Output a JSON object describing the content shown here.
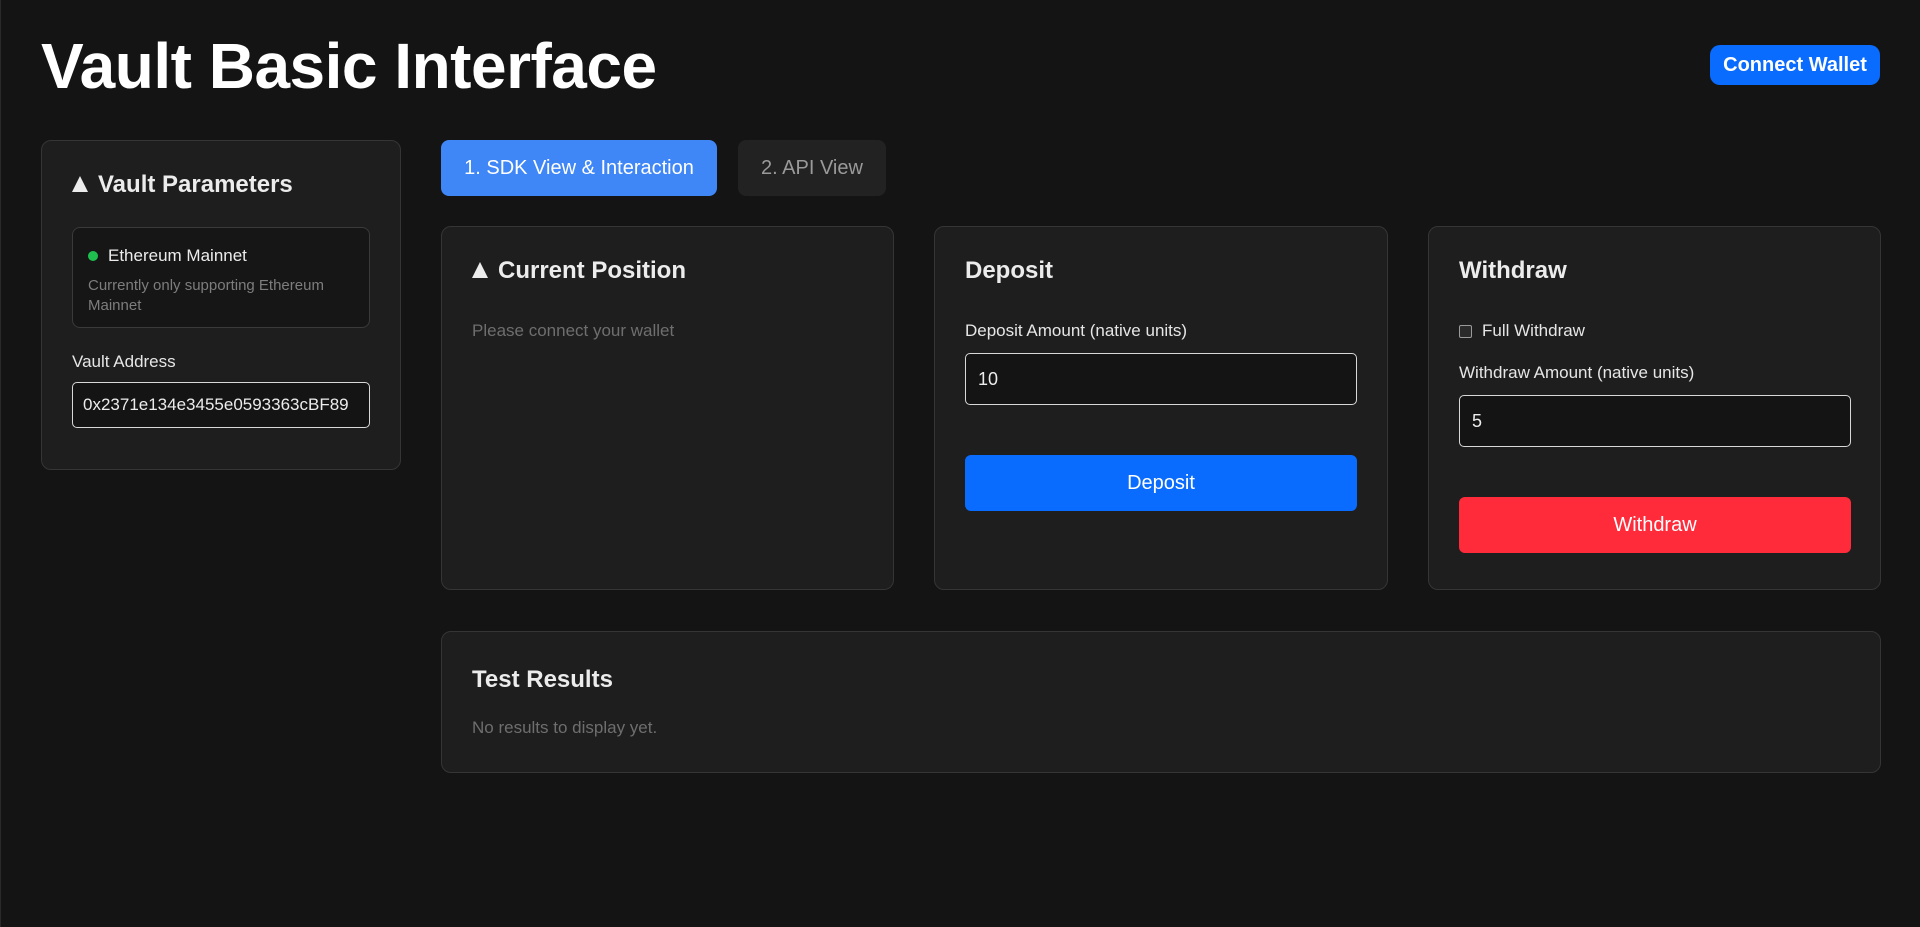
{
  "header": {
    "title": "Vault Basic Interface",
    "connect_label": "Connect Wallet"
  },
  "sidebar": {
    "title": "Vault Parameters",
    "network_name": "Ethereum Mainnet",
    "network_note": "Currently only supporting Ethereum Mainnet",
    "address_label": "Vault Address",
    "address_value": "0x2371e134e3455e0593363cBF89"
  },
  "tabs": [
    {
      "label": "1. SDK View & Interaction",
      "active": true
    },
    {
      "label": "2. API View",
      "active": false
    }
  ],
  "position": {
    "title": "Current Position",
    "empty_text": "Please connect your wallet"
  },
  "deposit": {
    "title": "Deposit",
    "amount_label": "Deposit Amount (native units)",
    "amount_value": "10",
    "button_label": "Deposit"
  },
  "withdraw": {
    "title": "Withdraw",
    "full_withdraw_label": "Full Withdraw",
    "full_withdraw_checked": false,
    "amount_label": "Withdraw Amount (native units)",
    "amount_value": "5",
    "button_label": "Withdraw"
  },
  "results": {
    "title": "Test Results",
    "empty_text": "No results to display yet."
  },
  "colors": {
    "background": "#141414",
    "card": "#1e1e1e",
    "primary": "#0a6cff",
    "tab_active": "#3f86f6",
    "danger": "#ff2b3a",
    "status_ok": "#1fbf4f"
  }
}
